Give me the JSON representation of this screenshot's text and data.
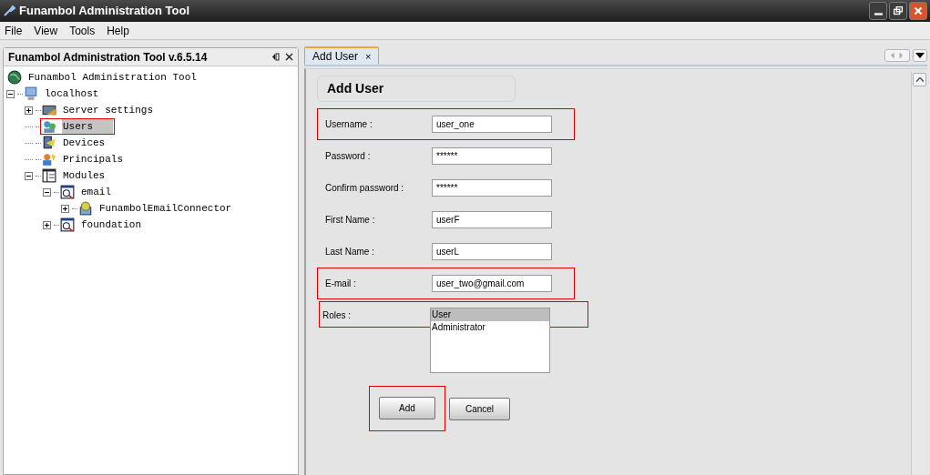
{
  "window": {
    "title": "Funambol Administration Tool"
  },
  "menu": [
    "File",
    "View",
    "Tools",
    "Help"
  ],
  "left_panel": {
    "title": "Funambol Administration Tool v.6.5.14",
    "tree": [
      {
        "label": "Funambol Administration Tool",
        "children": [
          {
            "label": "localhost",
            "expanded": true,
            "children": [
              {
                "label": "Server settings",
                "expanded": false,
                "selected": false,
                "highlighted": false
              },
              {
                "label": "Users",
                "selected": true,
                "highlighted": true
              },
              {
                "label": "Devices",
                "selected": false,
                "highlighted": false
              },
              {
                "label": "Principals",
                "selected": false,
                "highlighted": false
              },
              {
                "label": "Modules",
                "expanded": true,
                "selected": false,
                "highlighted": false,
                "children": [
                  {
                    "label": "email",
                    "expanded": true,
                    "selected": false,
                    "highlighted": false,
                    "children": [
                      {
                        "label": "FunambolEmailConnector",
                        "expanded": false,
                        "selected": false,
                        "highlighted": false
                      }
                    ]
                  },
                  {
                    "label": "foundation",
                    "expanded": false,
                    "selected": false,
                    "highlighted": false
                  }
                ]
              }
            ]
          }
        ]
      }
    ]
  },
  "tabs": [
    {
      "label": "Add User",
      "selected": true,
      "close": "×"
    }
  ],
  "form": {
    "title": "Add User",
    "fields": [
      {
        "label": "Username :",
        "value": "user_one",
        "highlighted": true
      },
      {
        "label": "Password :",
        "value": "******",
        "highlighted": false
      },
      {
        "label": "Confirm password :",
        "value": "******",
        "highlighted": false
      },
      {
        "label": "First Name :",
        "value": "userF",
        "highlighted": false
      },
      {
        "label": "Last Name :",
        "value": "userL",
        "highlighted": false
      },
      {
        "label": "E-mail :",
        "value": "user_two@gmail.com",
        "highlighted": true
      }
    ],
    "roles": {
      "label": "Roles :",
      "highlighted": true,
      "options": [
        {
          "label": "User",
          "selected": true
        },
        {
          "label": "Administrator",
          "selected": false
        }
      ]
    },
    "buttons": [
      {
        "label": "Add",
        "highlighted": true
      },
      {
        "label": "Cancel",
        "highlighted": false
      }
    ]
  }
}
